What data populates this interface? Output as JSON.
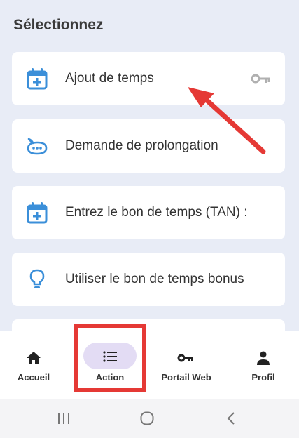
{
  "header": {
    "title": "Sélectionnez"
  },
  "options": [
    {
      "label": "Ajout de temps",
      "icon": "calendar-plus-icon",
      "trailing_icon": "key-icon"
    },
    {
      "label": "Demande de prolongation",
      "icon": "chat-bubble-icon"
    },
    {
      "label": "Entrez le bon de temps (TAN) :",
      "icon": "calendar-plus-icon"
    },
    {
      "label": "Utiliser le bon de temps bonus",
      "icon": "lightbulb-icon"
    }
  ],
  "bottom_nav": {
    "items": [
      {
        "label": "Accueil",
        "icon": "home-icon"
      },
      {
        "label": "Action",
        "icon": "list-icon",
        "active": true
      },
      {
        "label": "Portail Web",
        "icon": "key-icon"
      },
      {
        "label": "Profil",
        "icon": "person-icon"
      }
    ]
  },
  "colors": {
    "accent": "#3b8fd9",
    "annotation": "#e53935",
    "active_pill": "#e3dcf4",
    "background": "#e8ecf6"
  },
  "system_nav": [
    "recent-apps-icon",
    "home-circle-icon",
    "back-icon"
  ]
}
